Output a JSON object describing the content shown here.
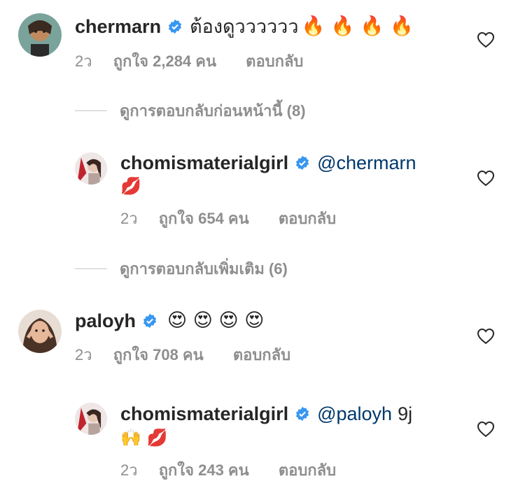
{
  "comments": [
    {
      "username": "chermarn",
      "text": "ต้องดูวววววว",
      "emoji": "🔥 🔥 🔥 🔥",
      "time": "2ว",
      "likes": "ถูกใจ 2,284 คน",
      "reply": "ตอบกลับ",
      "avatar_color": "#6a8f8a"
    }
  ],
  "view_previous": "ดูการตอบกลับก่อนหน้านี้ (8)",
  "reply1": {
    "username": "chomismaterialgirl",
    "mention": "@chermarn",
    "emoji": "💋",
    "time": "2ว",
    "likes": "ถูกใจ 654 คน",
    "reply": "ตอบกลับ"
  },
  "view_more": "ดูการตอบกลับเพิ่มเติม (6)",
  "comment2": {
    "username": "paloyh",
    "emoji": "😍 😍 😍 😍",
    "time": "2ว",
    "likes": "ถูกใจ 708 คน",
    "reply": "ตอบกลับ"
  },
  "reply2": {
    "username": "chomismaterialgirl",
    "mention": "@paloyh",
    "text": "9j",
    "emoji": "🙌 💋",
    "time": "2ว",
    "likes": "ถูกใจ 243 คน",
    "reply": "ตอบกลับ"
  },
  "colors": {
    "verified": "#3897f0",
    "mention": "#00376b",
    "secondary_text": "#8e8e8e"
  },
  "icons": [
    "verified-badge-icon",
    "heart-icon"
  ]
}
